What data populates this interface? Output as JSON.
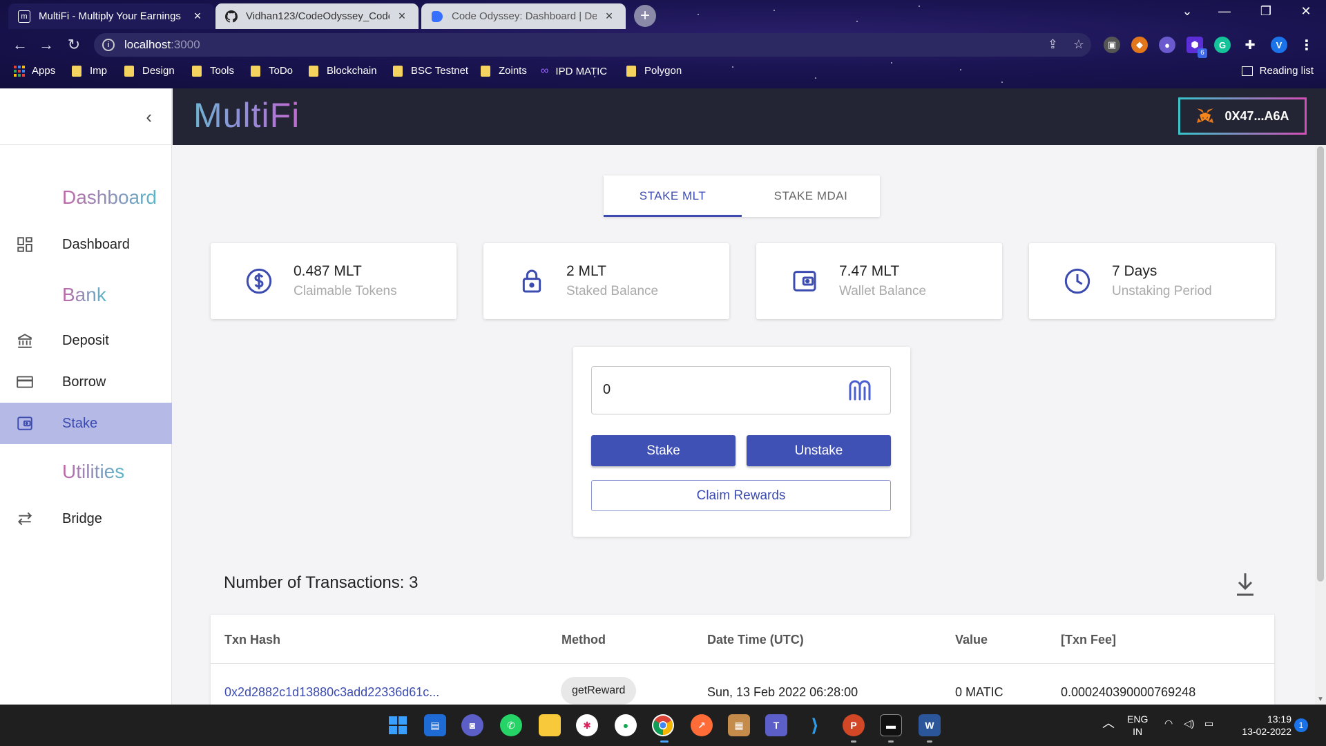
{
  "browser": {
    "tabs": [
      {
        "title": "MultiFi - Multiply Your Earnings",
        "active": true
      },
      {
        "title": "Vidhan123/CodeOdyssey_CodeX",
        "active": false
      },
      {
        "title": "Code Odyssey: Dashboard | Devf",
        "active": false
      }
    ],
    "url_host": "localhost",
    "url_port": ":3000",
    "extension_badge": "6",
    "profile_initial": "V",
    "bookmarks": [
      "Apps",
      "Imp",
      "Design",
      "Tools",
      "ToDo",
      "Blockchain",
      "BSC Testnet",
      "Zoints",
      "IPD MATIC",
      "Polygon"
    ],
    "reading_list": "Reading list"
  },
  "app": {
    "logo": "MultiFi",
    "wallet_address": "0X47...A6A",
    "sidebar": {
      "sections": [
        {
          "title": "Dashboard",
          "items": [
            {
              "label": "Dashboard",
              "icon": "dashboard-icon"
            }
          ]
        },
        {
          "title": "Bank",
          "items": [
            {
              "label": "Deposit",
              "icon": "bank-icon"
            },
            {
              "label": "Borrow",
              "icon": "credit-card-icon"
            },
            {
              "label": "Stake",
              "icon": "wallet-icon",
              "active": true
            }
          ]
        },
        {
          "title": "Utilities",
          "items": [
            {
              "label": "Bridge",
              "icon": "swap-arrows-icon"
            }
          ]
        }
      ]
    },
    "stake_tabs": [
      "STAKE MLT",
      "STAKE MDAI"
    ],
    "selected_tab": "STAKE MLT",
    "stats": [
      {
        "value": "0.487 MLT",
        "label": "Claimable Tokens",
        "icon": "dollar-circle-icon"
      },
      {
        "value": "2 MLT",
        "label": "Staked Balance",
        "icon": "lock-icon"
      },
      {
        "value": "7.47 MLT",
        "label": "Wallet Balance",
        "icon": "wallet-icon"
      },
      {
        "value": "7 Days",
        "label": "Unstaking Period",
        "icon": "clock-icon"
      }
    ],
    "stake_form": {
      "amount_value": "0",
      "stake_label": "Stake",
      "unstake_label": "Unstake",
      "claim_label": "Claim Rewards"
    },
    "transactions": {
      "count_label": "Number of Transactions: 3",
      "columns": [
        "Txn Hash",
        "Method",
        "Date Time (UTC)",
        "Value",
        "[Txn Fee]"
      ],
      "rows": [
        {
          "hash": "0x2d2882c1d13880c3add22336d61c...",
          "method": "getReward",
          "datetime": "Sun, 13 Feb 2022 06:28:00",
          "value": "0 MATIC",
          "fee": "0.000240390000769248"
        }
      ]
    }
  },
  "taskbar": {
    "lang_line1": "ENG",
    "lang_line2": "IN",
    "time": "13:19",
    "date": "13-02-2022",
    "notification_count": "1"
  }
}
